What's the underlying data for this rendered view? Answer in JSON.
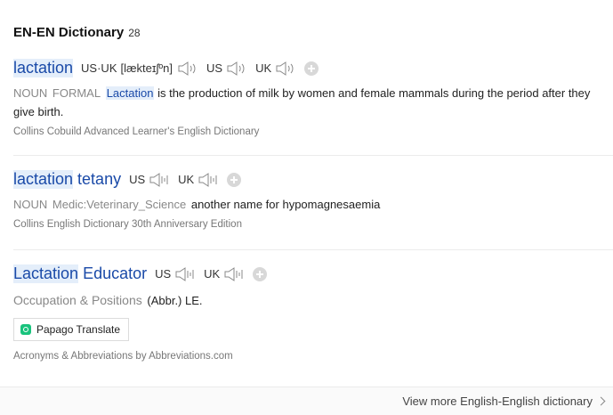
{
  "header": {
    "title": "EN-EN Dictionary",
    "count": "28"
  },
  "entries": [
    {
      "headword": "lactation",
      "pron_label": "US·UK",
      "ipa": "[lækteɪʃºn]",
      "region_us": "US",
      "region_uk": "UK",
      "pos": "NOUN",
      "register": "FORMAL",
      "def_word": "Lactation",
      "def_rest": "is the production of milk by women and female mammals during the period after they give birth.",
      "source": "Collins Cobuild Advanced Learner's English Dictionary"
    },
    {
      "headword_part1": "lactation",
      "headword_part2": "tetany",
      "region_us": "US",
      "region_uk": "UK",
      "pos": "NOUN",
      "field": "Medic:Veterinary_Science",
      "definition": "another name for hypomagnesaemia",
      "source": "Collins English Dictionary 30th Anniversary Edition"
    },
    {
      "headword_part1": "Lactation",
      "headword_part2": "Educator",
      "region_us": "US",
      "region_uk": "UK",
      "category": "Occupation & Positions",
      "definition": "(Abbr.) LE.",
      "translate_button": "Papago Translate",
      "source": "Acronyms & Abbreviations by Abbreviations.com"
    }
  ],
  "footer": {
    "more_link": "View more English-English dictionary"
  },
  "icons": {
    "speaker": "speaker-icon",
    "add": "plus-icon",
    "chevron": "chevron-right-icon",
    "papago": "papago-logo-icon"
  },
  "colors": {
    "headword": "#1a4aa8",
    "highlight": "#e4eefa"
  }
}
